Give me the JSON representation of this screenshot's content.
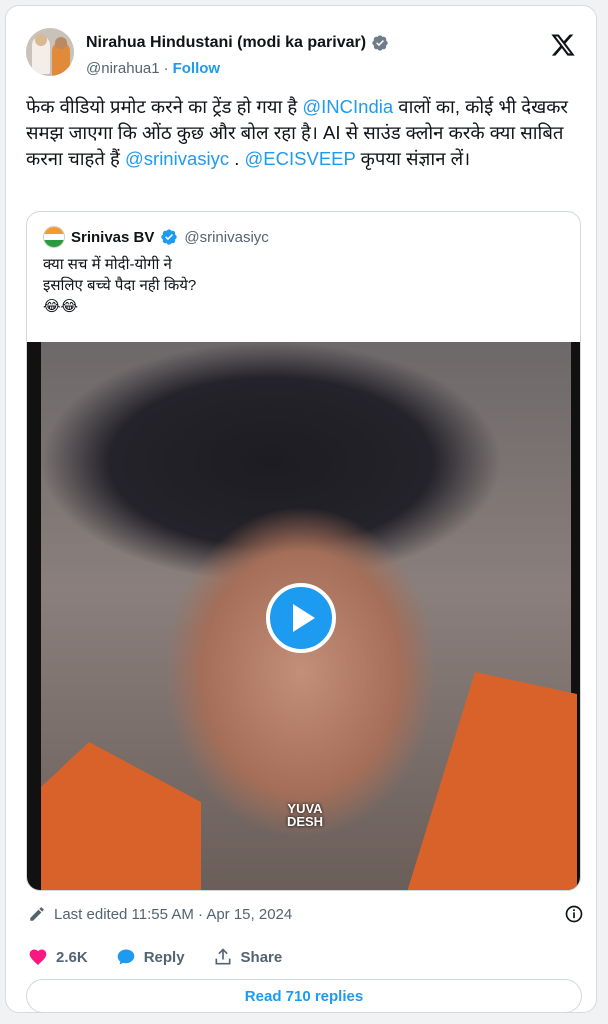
{
  "author": {
    "display_name": "Nirahua Hindustani (modi ka parivar)",
    "handle": "@nirahua1",
    "separator": "·",
    "follow_label": "Follow"
  },
  "tweet": {
    "text_1": "फेक वीडियो प्रमोट करने का ट्रेंड हो गया है ",
    "mention_1": "@INCIndia",
    "text_2": " वालों का, कोई भी देखकर समझ जाएगा कि ओंठ कुछ और बोल रहा है। AI से साउंड क्लोन करके क्या साबित करना चाहते हैं ",
    "mention_2": "@srinivasiyc",
    "text_3": " . ",
    "mention_3": "@ECISVEEP",
    "text_4": " कृपया संज्ञान लें।"
  },
  "quote": {
    "display_name": "Srinivas BV",
    "handle": "@srinivasiyc",
    "text": "क्या सच में मोदी-योगी ने\nइसलिए बच्चे पैदा नही किये?\n😂😂",
    "video_watermark": "YUVA DESH"
  },
  "meta": {
    "edited": "Last edited 11:55 AM · Apr 15, 2024"
  },
  "actions": {
    "likes": "2.6K",
    "reply_label": "Reply",
    "share_label": "Share",
    "read_replies": "Read 710 replies"
  },
  "colors": {
    "accent": "#1d9bf0",
    "like": "#f91880",
    "text": "#0f1419",
    "muted": "#536471"
  }
}
